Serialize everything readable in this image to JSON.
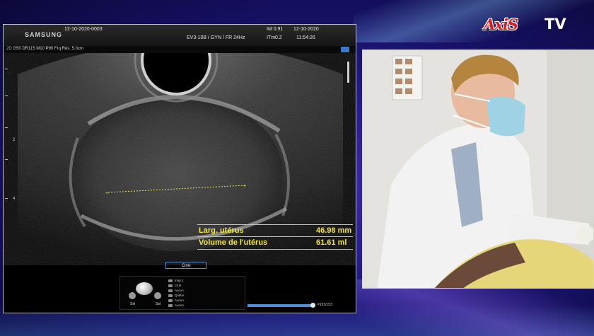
{
  "ultrasound": {
    "brand": "SAMSUNG",
    "patient_id": "12-10-2020-0003",
    "probe_info": "EV3-10B / GYN / FR 24Hz",
    "mi": "IM  0.91",
    "tim": "ITm0.2",
    "date": "12-10-2020",
    "time": "11:54:26",
    "mode": "2D",
    "params": "G50 DR115 M10 P90 Frq Rés. 5.0cm",
    "depth_labels": [
      "2",
      "4"
    ],
    "measurements": [
      {
        "label": "Larg. utérus",
        "value": "46.98 mm"
      },
      {
        "label": "Volume de l'utérus",
        "value": "61.61 ml"
      }
    ],
    "cine_label": "Ciné",
    "trackball": {
      "left_label": "Sel",
      "right_label": "Sel"
    },
    "menu_items": [
      "Imgr.1",
      "Ciné",
      "Aucun",
      "Quitter",
      "Aucun",
      "Aucun"
    ],
    "cine_progress": 0.98,
    "frame_counter": "#153/153"
  },
  "logo": {
    "axis": "AxiS",
    "tv": "TV",
    "color": "#d81e1e"
  },
  "video": {
    "description_visible": false
  }
}
